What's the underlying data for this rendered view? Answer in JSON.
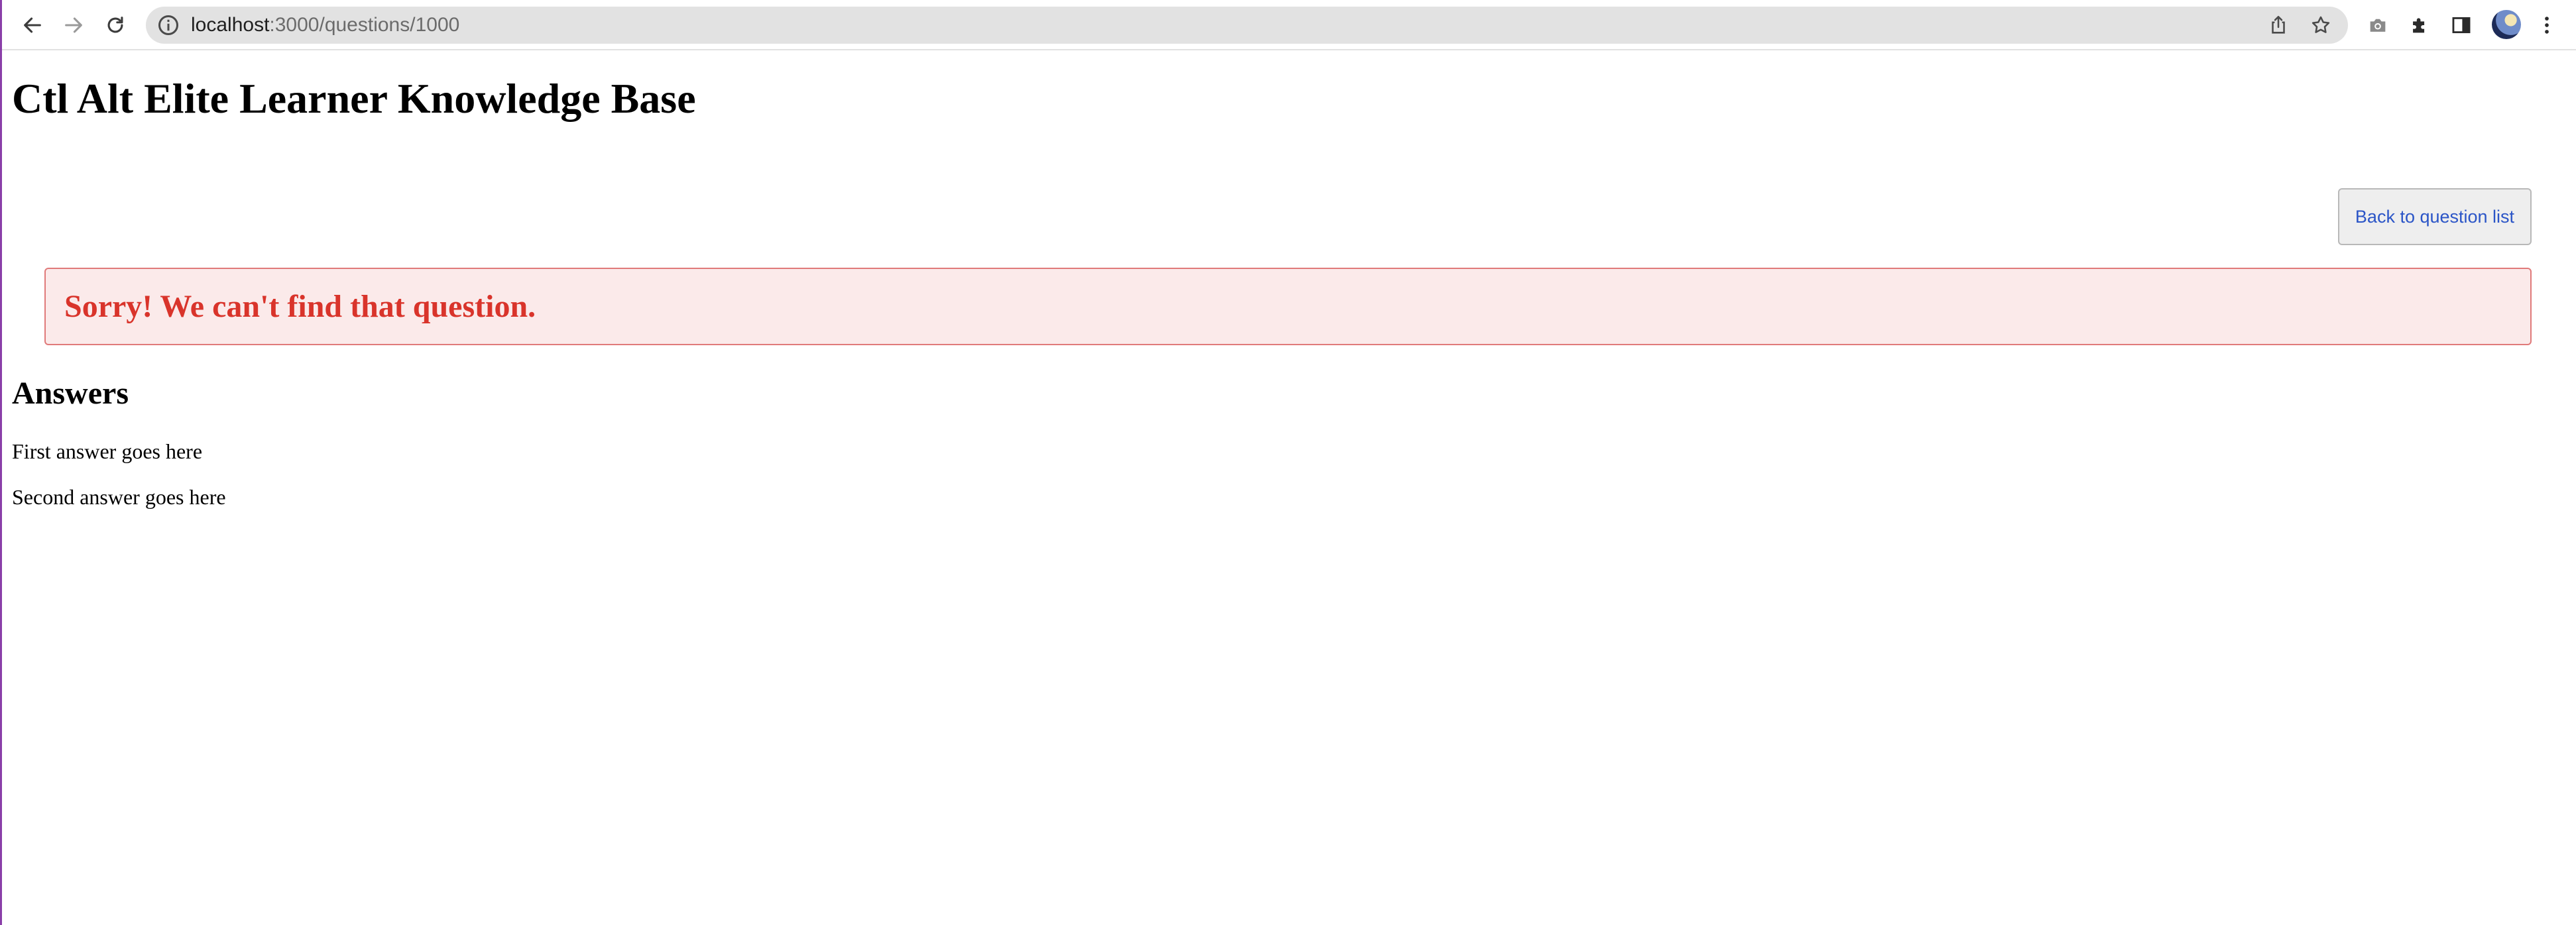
{
  "browser": {
    "url_host": "localhost",
    "url_path": ":3000/questions/1000"
  },
  "page": {
    "title": "Ctl Alt Elite Learner Knowledge Base",
    "back_button_label": "Back to question list",
    "error_message": "Sorry! We can't find that question.",
    "answers_heading": "Answers",
    "answers": [
      "First answer goes here",
      "Second answer goes here"
    ]
  },
  "colors": {
    "error_text": "#d9342b",
    "error_background": "#fbeaea",
    "error_border": "#e07a7a",
    "link_blue": "#2b55c7"
  },
  "icons": {
    "back": "back-arrow-icon",
    "forward": "forward-arrow-icon",
    "reload": "reload-icon",
    "site_info": "info-icon",
    "share": "share-icon",
    "bookmark": "star-icon",
    "camera": "camera-icon",
    "extensions": "puzzle-icon",
    "side_panel": "side-panel-icon",
    "menu": "kebab-menu-icon"
  }
}
